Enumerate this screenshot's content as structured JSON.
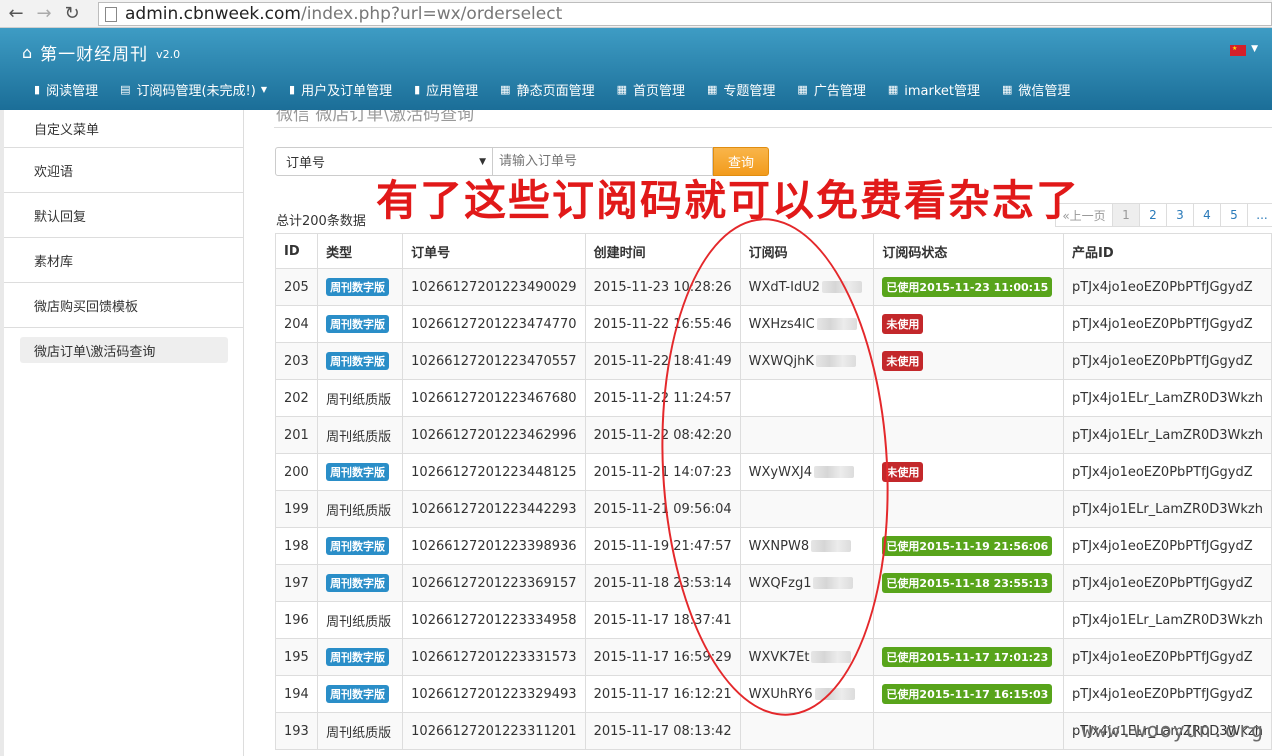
{
  "browser": {
    "url_host": "admin.cbnweek.com",
    "url_path": "/index.php?url=wx/orderselect"
  },
  "app": {
    "title": "第一财经周刊",
    "version": "v2.0"
  },
  "menu": [
    {
      "label": "阅读管理",
      "icon": "file-icon"
    },
    {
      "label": "订阅码管理(未完成!)",
      "icon": "list-icon",
      "dropdown": true
    },
    {
      "label": "用户及订单管理",
      "icon": "file-icon"
    },
    {
      "label": "应用管理",
      "icon": "file-icon"
    },
    {
      "label": "静态页面管理",
      "icon": "grid-icon"
    },
    {
      "label": "首页管理",
      "icon": "grid-icon"
    },
    {
      "label": "专题管理",
      "icon": "grid-icon"
    },
    {
      "label": "广告管理",
      "icon": "grid-icon"
    },
    {
      "label": "imarket管理",
      "icon": "grid-icon"
    },
    {
      "label": "微信管理",
      "icon": "grid-icon"
    }
  ],
  "sidebar": {
    "items": [
      "自定义菜单",
      "欢迎语",
      "默认回复",
      "素材库",
      "微店购买回馈模板",
      "微店订单\\激活码查询"
    ],
    "active_index": 5
  },
  "breadcrumb": "微信  微店订单\\激活码查询",
  "search": {
    "select_value": "订单号",
    "placeholder": "请输入订单号",
    "button": "查询"
  },
  "total_text": "总计200条数据",
  "pagination": {
    "prev": "«上一页",
    "pages": [
      "1",
      "2",
      "3",
      "4",
      "5"
    ],
    "more": "..."
  },
  "table": {
    "headers": [
      "ID",
      "类型",
      "订单号",
      "创建时间",
      "订阅码",
      "订阅码状态",
      "产品ID"
    ],
    "rows": [
      {
        "id": "205",
        "type": "周刊数字版",
        "type_badge": true,
        "order": "10266127201223490029",
        "time": "2015-11-23 10:28:26",
        "code": "WXdT-IdU2",
        "status": "已使用2015-11-23 11:00:15",
        "status_kind": "used",
        "product": "pTJx4jo1eoEZ0PbPTfJGgydZ"
      },
      {
        "id": "204",
        "type": "周刊数字版",
        "type_badge": true,
        "order": "10266127201223474770",
        "time": "2015-11-22 16:55:46",
        "code": "WXHzs4lC",
        "status": "未使用",
        "status_kind": "unused",
        "product": "pTJx4jo1eoEZ0PbPTfJGgydZ"
      },
      {
        "id": "203",
        "type": "周刊数字版",
        "type_badge": true,
        "order": "10266127201223470557",
        "time": "2015-11-22 18:41:49",
        "code": "WXWQjhK",
        "status": "未使用",
        "status_kind": "unused",
        "product": "pTJx4jo1eoEZ0PbPTfJGgydZ"
      },
      {
        "id": "202",
        "type": "周刊纸质版",
        "type_badge": false,
        "order": "10266127201223467680",
        "time": "2015-11-22 11:24:57",
        "code": "",
        "status": "",
        "status_kind": "",
        "product": "pTJx4jo1ELr_LamZR0D3Wkzh"
      },
      {
        "id": "201",
        "type": "周刊纸质版",
        "type_badge": false,
        "order": "10266127201223462996",
        "time": "2015-11-22 08:42:20",
        "code": "",
        "status": "",
        "status_kind": "",
        "product": "pTJx4jo1ELr_LamZR0D3Wkzh"
      },
      {
        "id": "200",
        "type": "周刊数字版",
        "type_badge": true,
        "order": "10266127201223448125",
        "time": "2015-11-21 14:07:23",
        "code": "WXyWXJ4",
        "status": "未使用",
        "status_kind": "unused",
        "product": "pTJx4jo1eoEZ0PbPTfJGgydZ"
      },
      {
        "id": "199",
        "type": "周刊纸质版",
        "type_badge": false,
        "order": "10266127201223442293",
        "time": "2015-11-21 09:56:04",
        "code": "",
        "status": "",
        "status_kind": "",
        "product": "pTJx4jo1ELr_LamZR0D3Wkzh"
      },
      {
        "id": "198",
        "type": "周刊数字版",
        "type_badge": true,
        "order": "10266127201223398936",
        "time": "2015-11-19 21:47:57",
        "code": "WXNPW8",
        "status": "已使用2015-11-19 21:56:06",
        "status_kind": "used",
        "product": "pTJx4jo1eoEZ0PbPTfJGgydZ"
      },
      {
        "id": "197",
        "type": "周刊数字版",
        "type_badge": true,
        "order": "10266127201223369157",
        "time": "2015-11-18 23:53:14",
        "code": "WXQFzg1",
        "status": "已使用2015-11-18 23:55:13",
        "status_kind": "used",
        "product": "pTJx4jo1eoEZ0PbPTfJGgydZ"
      },
      {
        "id": "196",
        "type": "周刊纸质版",
        "type_badge": false,
        "order": "10266127201223334958",
        "time": "2015-11-17 18:37:41",
        "code": "",
        "status": "",
        "status_kind": "",
        "product": "pTJx4jo1ELr_LamZR0D3Wkzh"
      },
      {
        "id": "195",
        "type": "周刊数字版",
        "type_badge": true,
        "order": "10266127201223331573",
        "time": "2015-11-17 16:59:29",
        "code": "WXVK7Et",
        "status": "已使用2015-11-17 17:01:23",
        "status_kind": "used",
        "product": "pTJx4jo1eoEZ0PbPTfJGgydZ"
      },
      {
        "id": "194",
        "type": "周刊数字版",
        "type_badge": true,
        "order": "10266127201223329493",
        "time": "2015-11-17 16:12:21",
        "code": "WXUhRY6",
        "status": "已使用2015-11-17 16:15:03",
        "status_kind": "used",
        "product": "pTJx4jo1eoEZ0PbPTfJGgydZ"
      },
      {
        "id": "193",
        "type": "周刊纸质版",
        "type_badge": false,
        "order": "10266127201223311201",
        "time": "2015-11-17 08:13:42",
        "code": "",
        "status": "",
        "status_kind": "",
        "product": "pTJx4jo1ELr_LamZR0D3Wkzh"
      }
    ]
  },
  "annotation": "有了这些订阅码就可以免费看杂志了",
  "watermark": "www.wooyun.org",
  "colors": {
    "header_top": "#3e9cc4",
    "header_bottom": "#1b6e98",
    "badge_blue": "#2a8ec8",
    "status_used": "#58a41b",
    "status_unused": "#c3282b",
    "query_button": "#f29b1c",
    "annotation_red": "#e11919"
  }
}
